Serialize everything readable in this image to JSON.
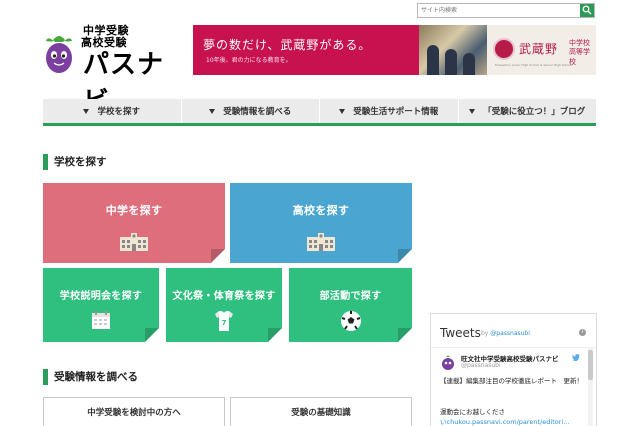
{
  "search": {
    "placeholder": "サイト内検索",
    "value": "サイト内検索"
  },
  "logo": {
    "line1": "中学受験",
    "line2": "高校受験",
    "line3": "パスナビ"
  },
  "banner": {
    "slogan": "夢の数だけ、武蔵野がある。",
    "sub": "10年後、君の力になる教育を。",
    "school_name": "武蔵野",
    "school_kind1": "中学校",
    "school_kind2": "高等学校",
    "school_english": "Musashino Junior High School & Senior High School",
    "accent_color": "#c7124f"
  },
  "nav": {
    "items": [
      {
        "label": "学校を探す"
      },
      {
        "label": "受験情報を調べる"
      },
      {
        "label": "受験生活サポート情報"
      },
      {
        "label": "「受験に役立つ！」ブログ"
      }
    ],
    "accent_color": "#2a9d58"
  },
  "section_find": {
    "title": "学校を探す",
    "tiles": [
      {
        "label": "中学を探す",
        "icon": "school-building-icon",
        "color": "#de6e7b"
      },
      {
        "label": "高校を探す",
        "icon": "school-building-icon",
        "color": "#4aa6d0"
      },
      {
        "label": "学校説明会を探す",
        "icon": "calendar-icon",
        "color": "#2fbf7f"
      },
      {
        "label": "文化祭・体育祭を探す",
        "icon": "sports-shirt-icon",
        "color": "#2fbf7f"
      },
      {
        "label": "部活動で探す",
        "icon": "soccer-ball-icon",
        "color": "#2fbf7f"
      }
    ]
  },
  "section_exam": {
    "title": "受験情報を調べる",
    "buttons": [
      {
        "label": "中学受験を検討中の方へ"
      },
      {
        "label": "受験の基礎知識"
      }
    ]
  },
  "tweets": {
    "title": "Tweets",
    "by_prefix": "by",
    "by_handle": "@passnasubi",
    "info_glyph": "i",
    "account_name": "旺文社中学受験高校受験パスナビ",
    "account_handle": "@passnasubi",
    "text_line1": "【連載】編集部注目の学校徹底レポート　更新！",
    "text_line2": "運動会にお越しくださ",
    "text_line3": "いchukou.passnavi.com/parent/editori..."
  }
}
